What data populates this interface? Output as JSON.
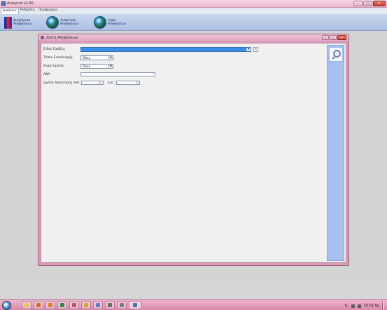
{
  "app": {
    "title": "Διαύγεια v2.00",
    "controls": {
      "minimize": "–",
      "maximize": "□",
      "close": "✕"
    }
  },
  "menu": [
    "Διαύγεια",
    "Ρυθμίσεις",
    "Περίφερημα"
  ],
  "ribbon": [
    {
      "label": "Διαχείριση\nΑποφάσεων",
      "icon": "book-icon"
    },
    {
      "label": "Ανάρτηση\nΑποφάσεων",
      "icon": "globe-icon"
    },
    {
      "label": "Λήψη\nΑποφάσεων",
      "icon": "globe-icon"
    }
  ],
  "child_window": {
    "title": "Λίστα Αποφάσεων",
    "controls": {
      "minimize": "–",
      "maximize": "□",
      "close": "✕"
    }
  },
  "form": {
    "decision_type": {
      "label": "Είδος Πράξης",
      "value": "",
      "clear": "×"
    },
    "org_type": {
      "label": "Τύπος Εκτελεσμής",
      "value": "Όλες"
    },
    "posted": {
      "label": "Αναρτημένες",
      "value": "Όλες"
    },
    "ada": {
      "label": "ΑΔΑ",
      "value": ""
    },
    "date_from": {
      "label": "Ημ/νία Ανάρτησης από",
      "value": ""
    },
    "date_to": {
      "label": "έως",
      "value": ""
    }
  },
  "side_panel": {
    "search_icon": "magnifier-icon"
  },
  "taskbar": {
    "apps": [
      "explorer-icon",
      "media-icon",
      "firefox-icon",
      "excel-icon",
      "paint-icon",
      "chrome-icon",
      "computer-icon",
      "outlook-icon",
      "word-icon",
      "app-icon"
    ],
    "lang": "EL",
    "clock": "10:52 πμ"
  }
}
